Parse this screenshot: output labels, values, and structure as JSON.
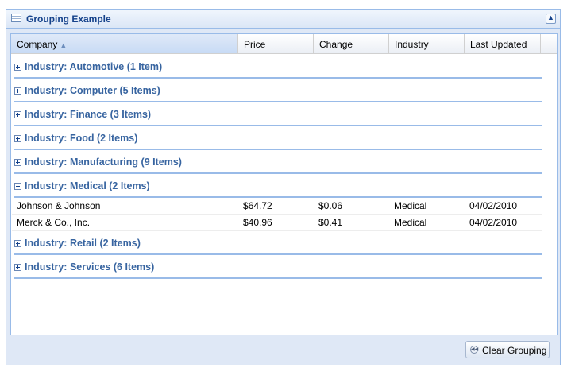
{
  "panel": {
    "title": "Grouping Example",
    "title_icon": "grid-table-icon",
    "collapse_icon": "collapse-up-icon"
  },
  "grid": {
    "columns": [
      {
        "label": "Company",
        "sorted": "asc"
      },
      {
        "label": "Price"
      },
      {
        "label": "Change"
      },
      {
        "label": "Industry"
      },
      {
        "label": "Last Updated"
      }
    ],
    "groups": [
      {
        "label": "Industry: Automotive (1 Item)",
        "expanded": false,
        "rows": []
      },
      {
        "label": "Industry: Computer (5 Items)",
        "expanded": false,
        "rows": []
      },
      {
        "label": "Industry: Finance (3 Items)",
        "expanded": false,
        "rows": []
      },
      {
        "label": "Industry: Food (2 Items)",
        "expanded": false,
        "rows": []
      },
      {
        "label": "Industry: Manufacturing (9 Items)",
        "expanded": false,
        "rows": []
      },
      {
        "label": "Industry: Medical (2 Items)",
        "expanded": true,
        "rows": [
          {
            "company": "Johnson & Johnson",
            "price": "$64.72",
            "change": "$0.06",
            "industry": "Medical",
            "updated": "04/02/2010"
          },
          {
            "company": "Merck & Co., Inc.",
            "price": "$40.96",
            "change": "$0.41",
            "industry": "Medical",
            "updated": "04/02/2010"
          }
        ]
      },
      {
        "label": "Industry: Retail (2 Items)",
        "expanded": false,
        "rows": []
      },
      {
        "label": "Industry: Services (6 Items)",
        "expanded": false,
        "rows": []
      }
    ]
  },
  "toolbar": {
    "clear_label": "Clear Grouping",
    "clear_icon": "rewind-icon"
  }
}
